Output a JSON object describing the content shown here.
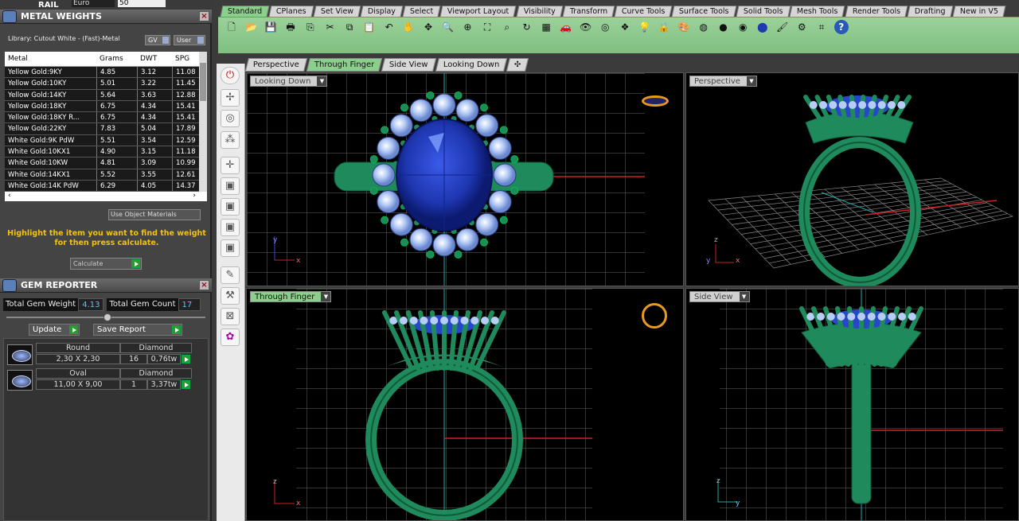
{
  "rail": {
    "label": "RAIL",
    "currency": "Euro",
    "qty": "50"
  },
  "metal_weights": {
    "title": "METAL WEIGHTS",
    "library": "Library: Cutout White - (Fast)-Metal",
    "gv": "GV",
    "user": "User",
    "columns": [
      "Metal",
      "Grams",
      "DWT",
      "SPG"
    ],
    "rows": [
      [
        "Yellow Gold:9KY",
        "4.85",
        "3.12",
        "11.08"
      ],
      [
        "Yellow Gold:10KY",
        "5.01",
        "3.22",
        "11.45"
      ],
      [
        "Yellow Gold:14KY",
        "5.64",
        "3.63",
        "12.88"
      ],
      [
        "Yellow Gold:18KY",
        "6.75",
        "4.34",
        "15.41"
      ],
      [
        "Yellow Gold:18KY R...",
        "6.75",
        "4.34",
        "15.41"
      ],
      [
        "Yellow Gold:22KY",
        "7.83",
        "5.04",
        "17.89"
      ],
      [
        "White Gold:9K PdW",
        "5.51",
        "3.54",
        "12.59"
      ],
      [
        "White Gold:10KX1",
        "4.90",
        "3.15",
        "11.18"
      ],
      [
        "White Gold:10KW",
        "4.81",
        "3.09",
        "10.99"
      ],
      [
        "White Gold:14KX1",
        "5.52",
        "3.55",
        "12.61"
      ],
      [
        "White Gold:14K PdW",
        "6.29",
        "4.05",
        "14.37"
      ]
    ],
    "use_object": "Use Object Materials",
    "hint": "Highlight the item you want to find the weight for then press calculate.",
    "calculate": "Calculate"
  },
  "gem_reporter": {
    "title": "GEM REPORTER",
    "total_weight_label": "Total Gem Weight",
    "total_weight": "4.13",
    "total_count_label": "Total Gem Count",
    "total_count": "17",
    "update": "Update",
    "save_report": "Save Report",
    "gems": [
      {
        "shape": "Round",
        "type": "Diamond",
        "size": "2,30 X 2,30",
        "count": "16",
        "weight": "0,76tw"
      },
      {
        "shape": "Oval",
        "type": "Diamond",
        "size": "11,00 X 9,00",
        "count": "1",
        "weight": "3,37tw"
      }
    ]
  },
  "top_tabs": [
    "Standard",
    "CPlanes",
    "Set View",
    "Display",
    "Select",
    "Viewport Layout",
    "Visibility",
    "Transform",
    "Curve Tools",
    "Surface Tools",
    "Solid Tools",
    "Mesh Tools",
    "Render Tools",
    "Drafting",
    "New in V5"
  ],
  "view_tabs": [
    "Perspective",
    "Through Finger",
    "Side View",
    "Looking Down"
  ],
  "viewports": {
    "tl": "Looking Down",
    "tr": "Perspective",
    "bl": "Through Finger",
    "br": "Side View"
  },
  "colors": {
    "ring": "#1f8a5c",
    "gem": "#2846c8",
    "accent": "#8ccf8c",
    "hint": "#f5c400"
  }
}
